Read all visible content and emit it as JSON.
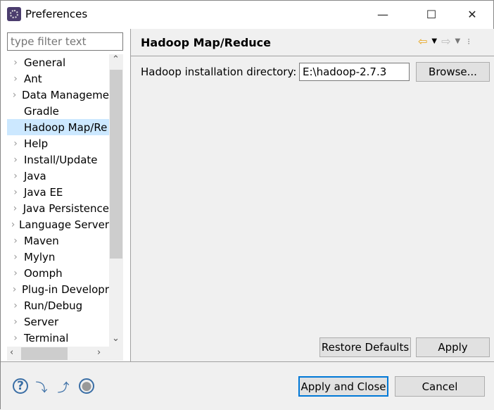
{
  "window": {
    "title": "Preferences",
    "minimize": "—",
    "maximize": "☐",
    "close": "✕"
  },
  "filter": {
    "placeholder": "type filter text"
  },
  "tree": {
    "items": [
      {
        "label": "General",
        "expandable": true
      },
      {
        "label": "Ant",
        "expandable": true
      },
      {
        "label": "Data Manageme",
        "expandable": true
      },
      {
        "label": "Gradle",
        "expandable": false
      },
      {
        "label": "Hadoop Map/Re",
        "expandable": false,
        "selected": true
      },
      {
        "label": "Help",
        "expandable": true
      },
      {
        "label": "Install/Update",
        "expandable": true
      },
      {
        "label": "Java",
        "expandable": true
      },
      {
        "label": "Java EE",
        "expandable": true
      },
      {
        "label": "Java Persistence",
        "expandable": true
      },
      {
        "label": "Language Server",
        "expandable": true
      },
      {
        "label": "Maven",
        "expandable": true
      },
      {
        "label": "Mylyn",
        "expandable": true
      },
      {
        "label": "Oomph",
        "expandable": true
      },
      {
        "label": "Plug-in Developr",
        "expandable": true
      },
      {
        "label": "Run/Debug",
        "expandable": true
      },
      {
        "label": "Server",
        "expandable": true
      },
      {
        "label": "Terminal",
        "expandable": true
      }
    ]
  },
  "page": {
    "title": "Hadoop Map/Reduce",
    "dir_label": "Hadoop installation directory:",
    "dir_value": "E:\\hadoop-2.7.3",
    "browse": "Browse...",
    "restore": "Restore Defaults",
    "apply": "Apply"
  },
  "footer": {
    "apply_close": "Apply and Close",
    "cancel": "Cancel"
  },
  "colors": {
    "selection": "#cce8ff",
    "panel": "#f0f0f0",
    "back_arrow": "#e8a317"
  }
}
